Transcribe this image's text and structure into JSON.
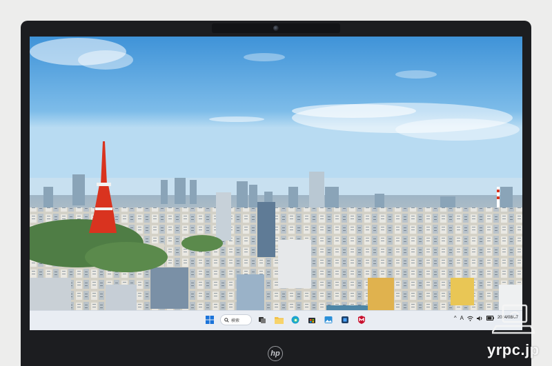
{
  "taskbar": {
    "search_placeholder": "検索",
    "apps": [
      {
        "name": "start-icon"
      },
      {
        "name": "search-box"
      },
      {
        "name": "task-view-icon"
      },
      {
        "name": "file-explorer-icon"
      },
      {
        "name": "edge-icon"
      },
      {
        "name": "store-icon"
      },
      {
        "name": "photos-icon"
      },
      {
        "name": "security-icon"
      },
      {
        "name": "mcafee-icon"
      }
    ],
    "tray_lang": "A",
    "date": "2024/08/07"
  },
  "brand": {
    "logo_text": "hp"
  },
  "watermark": {
    "text": "yrpc.jp"
  },
  "colors": {
    "sky": "#57a5de",
    "taskbar": "#e9edf3",
    "bezel": "#1c1d20",
    "tower": "#d9331f"
  }
}
